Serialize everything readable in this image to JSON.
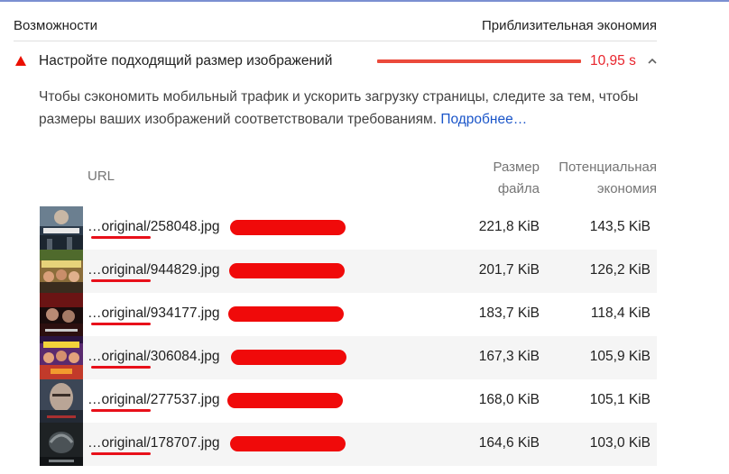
{
  "header": {
    "left_label": "Возможности",
    "right_label": "Приблизительная экономия"
  },
  "audit": {
    "title": "Настройте подходящий размер изображений",
    "savings": "10,95 s",
    "status_color": "#eb0f00",
    "description": "Чтобы сэкономить мобильный трафик и ускорить загрузку страницы, следите за тем, чтобы размеры ваших изображений соответствовали требованиям. ",
    "learn_more": "Подробнее…",
    "expanded": true
  },
  "table": {
    "col_url": "URL",
    "col_size": "Размер файла",
    "col_savings": "Потенциальная экономия",
    "rows": [
      {
        "url": "…original/258048.jpg",
        "size": "221,8 KiB",
        "savings": "143,5 KiB",
        "thumb": "poster-escape"
      },
      {
        "url": "…original/944829.jpg",
        "size": "201,7 KiB",
        "savings": "126,2 KiB",
        "thumb": "poster-group"
      },
      {
        "url": "…original/934177.jpg",
        "size": "183,7 KiB",
        "savings": "118,4 KiB",
        "thumb": "poster-red"
      },
      {
        "url": "…original/306084.jpg",
        "size": "167,3 KiB",
        "savings": "105,9 KiB",
        "thumb": "poster-explosion"
      },
      {
        "url": "…original/277537.jpg",
        "size": "168,0 KiB",
        "savings": "105,1 KiB",
        "thumb": "poster-face"
      },
      {
        "url": "…original/178707.jpg",
        "size": "164,6 KiB",
        "savings": "103,0 KiB",
        "thumb": "poster-dark"
      }
    ]
  }
}
